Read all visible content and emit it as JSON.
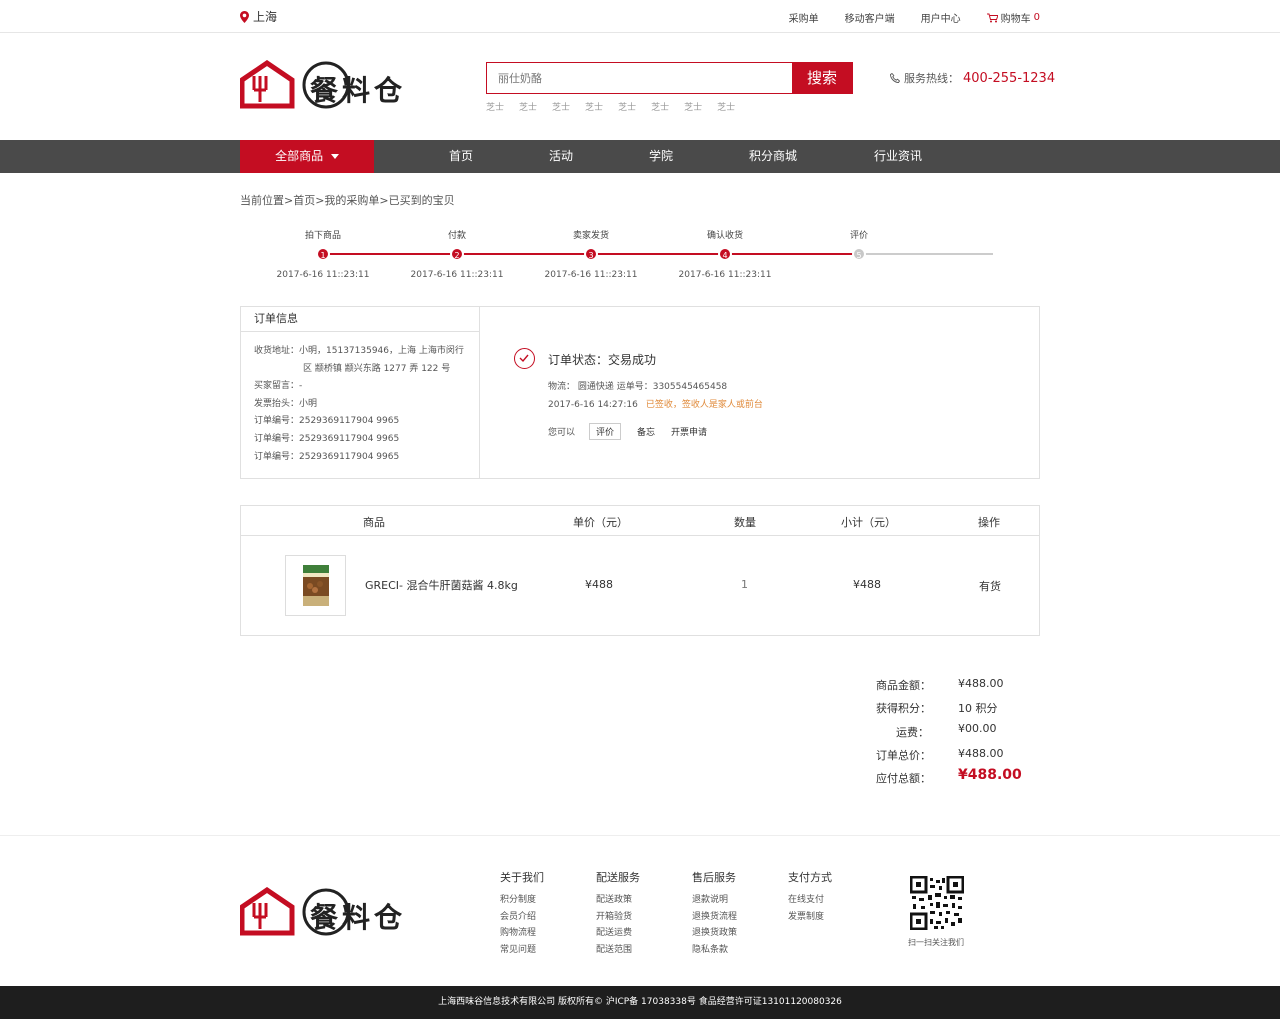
{
  "topbar": {
    "location": "上海",
    "links": [
      "采购单",
      "移动客户端",
      "用户中心"
    ],
    "cart_label": "购物车",
    "cart_count": "0"
  },
  "header": {
    "logo_text": "餐料仓",
    "search_placeholder": "丽仕奶酪",
    "search_button": "搜索",
    "hot_words": [
      "芝士",
      "芝士",
      "芝士",
      "芝士",
      "芝士",
      "芝士",
      "芝士",
      "芝士"
    ],
    "hotline_label": "服务热线：",
    "hotline_number": "400-255-1234"
  },
  "nav": {
    "all_categories": "全部商品",
    "items": [
      "首页",
      "活动",
      "学院",
      "积分商城",
      "行业资讯"
    ]
  },
  "breadcrumb": "当前位置>首页>我的采购单>已买到的宝贝",
  "steps": [
    {
      "num": "1",
      "label": "拍下商品",
      "time": "2017-6-16  11::23:11",
      "done": true
    },
    {
      "num": "2",
      "label": "付款",
      "time": "2017-6-16  11::23:11",
      "done": true
    },
    {
      "num": "3",
      "label": "卖家发货",
      "time": "2017-6-16  11::23:11",
      "done": true
    },
    {
      "num": "4",
      "label": "确认收货",
      "time": "2017-6-16  11::23:11",
      "done": true
    },
    {
      "num": "5",
      "label": "评价",
      "time": "",
      "done": false
    }
  ],
  "order_info": {
    "title": "订单信息",
    "address_label": "收货地址：",
    "address_line1": "小明，15137135946，上海 上海市闵行",
    "address_line2": "区 颛桥镇 颛兴东路 1277 弄 122 号",
    "message": "买家留言：-",
    "invoice": "发票抬头：小明",
    "order_numbers": [
      "订单编号：2529369117904 9965",
      "订单编号：2529369117904 9965",
      "订单编号：2529369117904 9965"
    ]
  },
  "status": {
    "text": "订单状态：交易成功",
    "logistics": "物流：  圆通快递    运单号：3305545465458",
    "time": "2017-6-16    14:27:16",
    "sign_note": "已签收，签收人是家人或前台",
    "you_can": "您可以",
    "action_review": "评价",
    "action_memo": "备忘",
    "action_invoice": "开票申请"
  },
  "product_table": {
    "headers": [
      "商品",
      "单价（元）",
      "数量",
      "小计（元）",
      "操作"
    ],
    "row": {
      "name": "GRECI- 混合牛肝菌菇酱 4.8kg",
      "price": "¥488",
      "qty": "1",
      "subtotal": "¥488",
      "operation": "有货"
    }
  },
  "summary": [
    {
      "label": "商品金额：",
      "value": "¥488.00"
    },
    {
      "label": "获得积分：",
      "value": "10 积分"
    },
    {
      "label": "运费：",
      "value": "¥00.00"
    },
    {
      "label": "订单总价：",
      "value": "¥488.00"
    },
    {
      "label": "应付总额：",
      "value": "¥488.00"
    }
  ],
  "footer": {
    "columns": [
      {
        "title": "关于我们",
        "items": [
          "积分制度",
          "会员介绍",
          "购物流程",
          "常见问题"
        ]
      },
      {
        "title": "配送服务",
        "items": [
          "配送政策",
          "开箱验货",
          "配送运费",
          "配送范围"
        ]
      },
      {
        "title": "售后服务",
        "items": [
          "退款说明",
          "退换货流程",
          "退换货政策",
          "隐私条款"
        ]
      },
      {
        "title": "支付方式",
        "items": [
          "在线支付",
          "发票制度"
        ]
      }
    ],
    "qr_text": "扫一扫关注我们",
    "copyright": "上海西味谷信息技术有限公司  版权所有©  沪ICP备 17038338号  食品经营许可证13101120080326"
  },
  "colors": {
    "accent": "#c40d22",
    "nav_bg": "#4a4a4a",
    "footer_bg": "#1e1e1e",
    "sign_note": "#e08a3a"
  }
}
